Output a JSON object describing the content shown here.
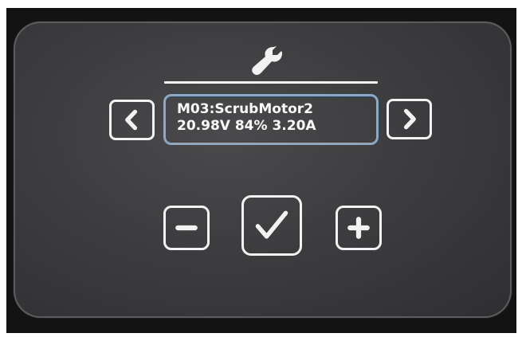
{
  "header": {
    "icon": "wrench-icon"
  },
  "navigation": {
    "prev_icon": "chevron-left-icon",
    "next_icon": "chevron-right-icon"
  },
  "motor_display": {
    "name_line": "M03:ScrubMotor2",
    "status_line": "20.98V 84% 3.20A"
  },
  "controls": {
    "decrease_icon": "minus-icon",
    "confirm_icon": "checkmark-icon",
    "increase_icon": "plus-icon"
  },
  "colors": {
    "foreground": "#f2f2f2",
    "display_border": "#8aa8c8",
    "panel": "#3d3d3f"
  }
}
